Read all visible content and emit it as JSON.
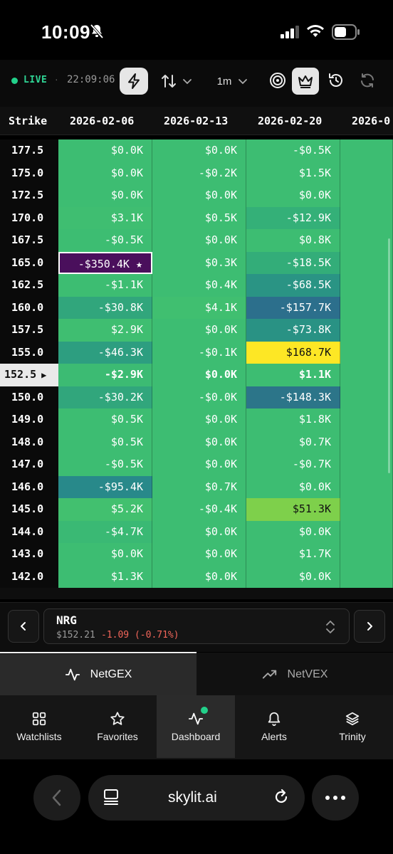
{
  "status_bar": {
    "time": "10:09"
  },
  "toolbar": {
    "live_label": "LIVE",
    "separator": "·",
    "timestamp": "22:09:06",
    "interval": "1m"
  },
  "table": {
    "columns": [
      "Strike",
      "2026-02-06",
      "2026-02-13",
      "2026-02-20",
      "2026-0"
    ],
    "current_marker": "▶",
    "rows": [
      {
        "strike": "177.5",
        "cells": [
          {
            "v": "$0.0K",
            "bg": "#3dbd72"
          },
          {
            "v": "$0.0K",
            "bg": "#3dbd72"
          },
          {
            "v": "-$0.5K",
            "bg": "#3dbd72"
          },
          {
            "v": "",
            "bg": "#3dbd72"
          }
        ]
      },
      {
        "strike": "175.0",
        "cells": [
          {
            "v": "$0.0K",
            "bg": "#3dbd72"
          },
          {
            "v": "-$0.2K",
            "bg": "#3dbd72"
          },
          {
            "v": "$1.5K",
            "bg": "#3dbd72"
          },
          {
            "v": "",
            "bg": "#3dbd72"
          }
        ]
      },
      {
        "strike": "172.5",
        "cells": [
          {
            "v": "$0.0K",
            "bg": "#3dbd72"
          },
          {
            "v": "$0.0K",
            "bg": "#3dbd72"
          },
          {
            "v": "$0.0K",
            "bg": "#3dbd72"
          },
          {
            "v": "",
            "bg": "#3dbd72"
          }
        ]
      },
      {
        "strike": "170.0",
        "cells": [
          {
            "v": "$3.1K",
            "bg": "#3fbe71"
          },
          {
            "v": "$0.5K",
            "bg": "#3dbd72"
          },
          {
            "v": "-$12.9K",
            "bg": "#34b078"
          },
          {
            "v": "",
            "bg": "#3dbd72"
          }
        ]
      },
      {
        "strike": "167.5",
        "cells": [
          {
            "v": "-$0.5K",
            "bg": "#3dbd72"
          },
          {
            "v": "$0.0K",
            "bg": "#3dbd72"
          },
          {
            "v": "$0.8K",
            "bg": "#3dbd72"
          },
          {
            "v": "",
            "bg": "#3dbd72"
          }
        ]
      },
      {
        "strike": "165.0",
        "cells": [
          {
            "v": "-$350.4K ★",
            "bg": "#4a0f5c",
            "hl": true
          },
          {
            "v": "$0.3K",
            "bg": "#3dbd72"
          },
          {
            "v": "-$18.5K",
            "bg": "#33ad79"
          },
          {
            "v": "",
            "bg": "#3dbd72"
          }
        ]
      },
      {
        "strike": "162.5",
        "cells": [
          {
            "v": "-$1.1K",
            "bg": "#3dbd72"
          },
          {
            "v": "$0.4K",
            "bg": "#3dbd72"
          },
          {
            "v": "-$68.5K",
            "bg": "#2a9484"
          },
          {
            "v": "",
            "bg": "#3dbd72"
          }
        ]
      },
      {
        "strike": "160.0",
        "cells": [
          {
            "v": "-$30.8K",
            "bg": "#31a67c"
          },
          {
            "v": "$4.1K",
            "bg": "#40bf70"
          },
          {
            "v": "-$157.7K",
            "bg": "#2c6f8c"
          },
          {
            "v": "",
            "bg": "#3dbd72"
          }
        ]
      },
      {
        "strike": "157.5",
        "cells": [
          {
            "v": "$2.9K",
            "bg": "#3fbe71"
          },
          {
            "v": "$0.0K",
            "bg": "#3dbd72"
          },
          {
            "v": "-$73.8K",
            "bg": "#299284"
          },
          {
            "v": "",
            "bg": "#3dbd72"
          }
        ]
      },
      {
        "strike": "155.0",
        "cells": [
          {
            "v": "-$46.3K",
            "bg": "#2d9e80"
          },
          {
            "v": "-$0.1K",
            "bg": "#3dbd72"
          },
          {
            "v": "$168.7K",
            "bg": "#fde725"
          },
          {
            "v": "",
            "bg": "#3dbd72"
          }
        ]
      },
      {
        "strike": "152.5",
        "current": true,
        "bold": true,
        "cells": [
          {
            "v": "-$2.9K",
            "bg": "#3cbb73"
          },
          {
            "v": "$0.0K",
            "bg": "#3dbd72"
          },
          {
            "v": "$1.1K",
            "bg": "#3dbd72"
          },
          {
            "v": "",
            "bg": "#3dbd72"
          }
        ]
      },
      {
        "strike": "150.0",
        "cells": [
          {
            "v": "-$30.2K",
            "bg": "#31a67c"
          },
          {
            "v": "-$0.0K",
            "bg": "#3dbd72"
          },
          {
            "v": "-$148.3K",
            "bg": "#2c7589"
          },
          {
            "v": "",
            "bg": "#3dbd72"
          }
        ]
      },
      {
        "strike": "149.0",
        "cells": [
          {
            "v": "$0.5K",
            "bg": "#3dbd72"
          },
          {
            "v": "$0.0K",
            "bg": "#3dbd72"
          },
          {
            "v": "$1.8K",
            "bg": "#3dbd72"
          },
          {
            "v": "",
            "bg": "#3dbd72"
          }
        ]
      },
      {
        "strike": "148.0",
        "cells": [
          {
            "v": "$0.5K",
            "bg": "#3dbd72"
          },
          {
            "v": "$0.0K",
            "bg": "#3dbd72"
          },
          {
            "v": "$0.7K",
            "bg": "#3dbd72"
          },
          {
            "v": "",
            "bg": "#3dbd72"
          }
        ]
      },
      {
        "strike": "147.0",
        "cells": [
          {
            "v": "-$0.5K",
            "bg": "#3dbd72"
          },
          {
            "v": "$0.0K",
            "bg": "#3dbd72"
          },
          {
            "v": "-$0.7K",
            "bg": "#3dbd72"
          },
          {
            "v": "",
            "bg": "#3dbd72"
          }
        ]
      },
      {
        "strike": "146.0",
        "cells": [
          {
            "v": "-$95.4K",
            "bg": "#28898a"
          },
          {
            "v": "$0.7K",
            "bg": "#3dbd72"
          },
          {
            "v": "$0.0K",
            "bg": "#3dbd72"
          },
          {
            "v": "",
            "bg": "#3dbd72"
          }
        ]
      },
      {
        "strike": "145.0",
        "cells": [
          {
            "v": "$5.2K",
            "bg": "#42c06f"
          },
          {
            "v": "-$0.4K",
            "bg": "#3dbd72"
          },
          {
            "v": "$51.3K",
            "bg": "#7ed04b"
          },
          {
            "v": "",
            "bg": "#3dbd72"
          }
        ]
      },
      {
        "strike": "144.0",
        "cells": [
          {
            "v": "-$4.7K",
            "bg": "#3ab974"
          },
          {
            "v": "$0.0K",
            "bg": "#3dbd72"
          },
          {
            "v": "$0.0K",
            "bg": "#3dbd72"
          },
          {
            "v": "",
            "bg": "#3dbd72"
          }
        ]
      },
      {
        "strike": "143.0",
        "cells": [
          {
            "v": "$0.0K",
            "bg": "#3dbd72"
          },
          {
            "v": "$0.0K",
            "bg": "#3dbd72"
          },
          {
            "v": "$1.7K",
            "bg": "#3dbd72"
          },
          {
            "v": "",
            "bg": "#3dbd72"
          }
        ]
      },
      {
        "strike": "142.0",
        "cells": [
          {
            "v": "$1.3K",
            "bg": "#3dbd72"
          },
          {
            "v": "$0.0K",
            "bg": "#3dbd72"
          },
          {
            "v": "$0.0K",
            "bg": "#3dbd72"
          },
          {
            "v": "",
            "bg": "#3dbd72"
          }
        ]
      }
    ]
  },
  "ticker": {
    "symbol": "NRG",
    "price": "$152.21",
    "change": "-1.09 (-0.71%)",
    "change_color": "#f2665a"
  },
  "metric_tabs": [
    {
      "label": "NetGEX",
      "icon": "activity-icon",
      "active": true
    },
    {
      "label": "NetVEX",
      "icon": "trending-up-icon",
      "active": false
    }
  ],
  "bottom_nav": [
    {
      "label": "Watchlists",
      "icon": "grid-icon"
    },
    {
      "label": "Favorites",
      "icon": "star-icon"
    },
    {
      "label": "Dashboard",
      "icon": "activity-icon",
      "active": true
    },
    {
      "label": "Alerts",
      "icon": "bell-icon"
    },
    {
      "label": "Trinity",
      "icon": "layers-icon"
    }
  ],
  "browser": {
    "url": "skylit.ai"
  },
  "colors": {
    "live": "#22d08a",
    "accent_green": "#3dbd72"
  }
}
